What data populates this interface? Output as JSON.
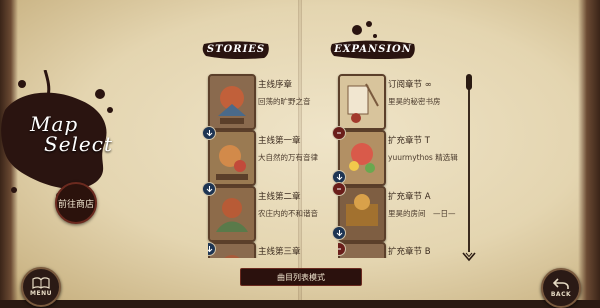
{
  "left_panel": {
    "title_line1": "Map",
    "title_line2": "Select",
    "shop_button": "前往商店",
    "menu_button": "MENU"
  },
  "headers": {
    "stories": "STORIES",
    "expansion": "EXPANSION"
  },
  "stories": [
    {
      "title": "主线序章",
      "subtitle": "回荡的旷野之音",
      "badge": false
    },
    {
      "title": "主线第一章",
      "subtitle": "大自然的万有音律",
      "badge": true
    },
    {
      "title": "主线第二章",
      "subtitle": "农庄内的不和谐音",
      "badge": true
    },
    {
      "title": "主线第三章",
      "subtitle": "",
      "badge": true
    }
  ],
  "expansion": [
    {
      "title": "订阅章节 ∞",
      "subtitle": "里昊的秘密书房",
      "badge": false
    },
    {
      "title": "扩充章节 T",
      "subtitle": "yuurmythos 精选辑",
      "badge": true
    },
    {
      "title": "扩充章节 A",
      "subtitle": "里昊的房间　—日—",
      "badge": true
    },
    {
      "title": "扩充章节 B",
      "subtitle": "",
      "badge": true
    }
  ],
  "bottom": {
    "list_mode_button": "曲目列表模式",
    "back_button": "BACK"
  },
  "colors": {
    "paper": "#e8dbb8",
    "ink": "#2a1410",
    "badge_blue": "#1e3553",
    "badge_red": "#6a1e1a"
  },
  "icons": [
    "book-icon",
    "back-arrow-icon",
    "download-icon",
    "scroll-down-icon"
  ]
}
